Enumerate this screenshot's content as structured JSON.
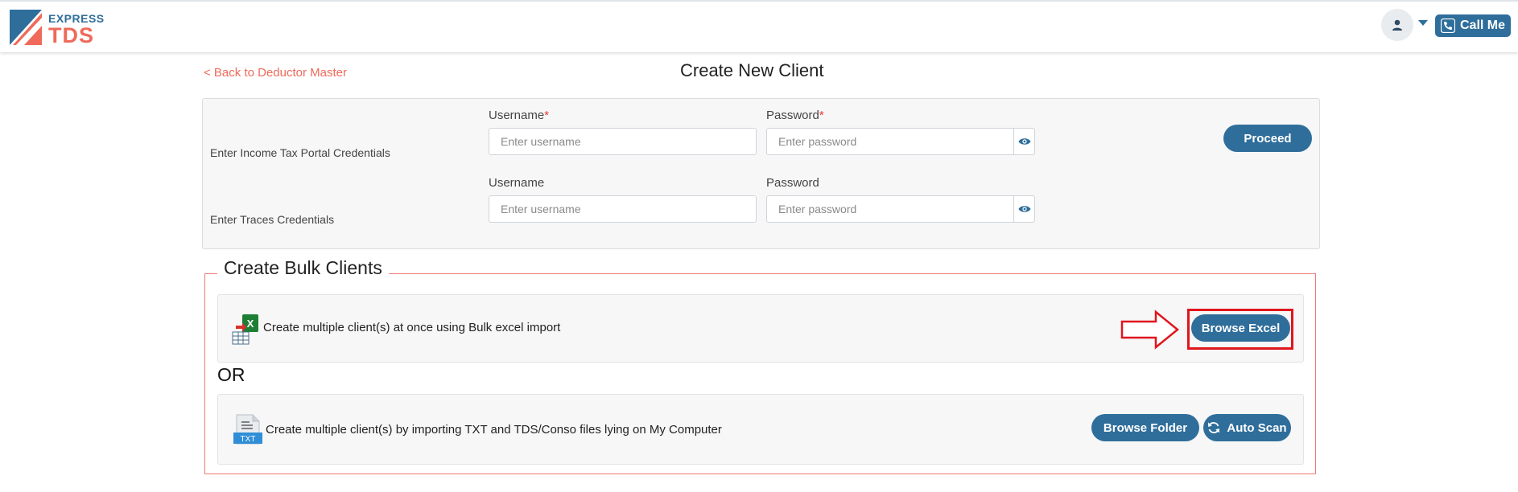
{
  "header": {
    "logo_express": "EXPRESS",
    "logo_tds": "TDS",
    "call_me_label": "Call Me",
    "avatar_icon": "user-icon",
    "caret_icon": "caret-down-icon",
    "phone_icon": "phone-icon"
  },
  "nav": {
    "back_link": "< Back to Deductor Master"
  },
  "page_title": "Create New Client",
  "credentials": {
    "income_tax": {
      "label": "Enter Income Tax Portal Credentials",
      "username_label": "Username",
      "password_label": "Password",
      "required_mark": "*",
      "username_placeholder": "Enter username",
      "password_placeholder": "Enter password"
    },
    "traces": {
      "label": "Enter Traces Credentials",
      "username_label": "Username",
      "password_label": "Password",
      "username_placeholder": "Enter username",
      "password_placeholder": "Enter password"
    },
    "proceed_label": "Proceed"
  },
  "bulk": {
    "legend": "Create Bulk Clients",
    "excel_text": "Create multiple client(s) at once using Bulk excel import",
    "browse_excel_label": "Browse Excel",
    "or_label": "OR",
    "txt_text": "Create multiple client(s) by importing TXT and TDS/Conso files lying on My Computer",
    "browse_folder_label": "Browse Folder",
    "auto_scan_label": "Auto Scan",
    "txt_icon_label": "TXT",
    "excel_icon_label": "X"
  },
  "colors": {
    "primary": "#2f6e9b",
    "accent": "#ef6a5a",
    "highlight": "#e0161d"
  }
}
